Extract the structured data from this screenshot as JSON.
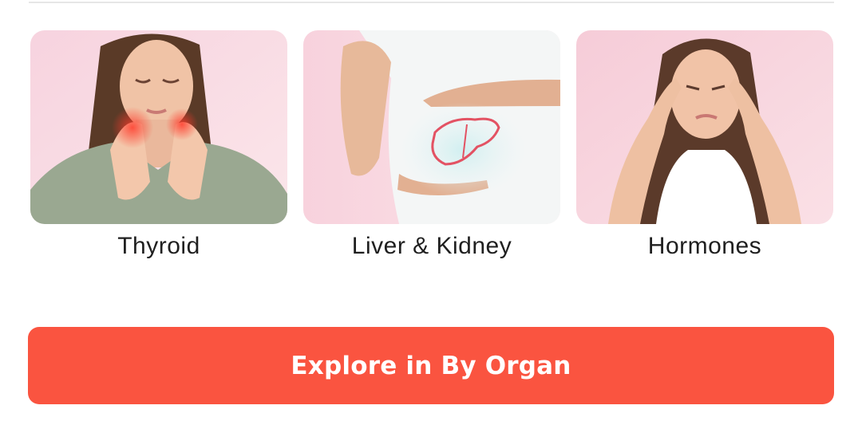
{
  "categories": [
    {
      "label": "Thyroid",
      "image": "woman-touching-neck-thyroid-image"
    },
    {
      "label": "Liver & Kidney",
      "image": "torso-with-liver-illustration-image"
    },
    {
      "label": "Hormones",
      "image": "woman-with-headache-image"
    }
  ],
  "cta": {
    "label": "Explore in By Organ"
  },
  "colors": {
    "cta_background": "#fa5440",
    "card_background": "#f7d9e1",
    "label_text": "#1f1f1f",
    "divider": "#e6e6e6"
  }
}
